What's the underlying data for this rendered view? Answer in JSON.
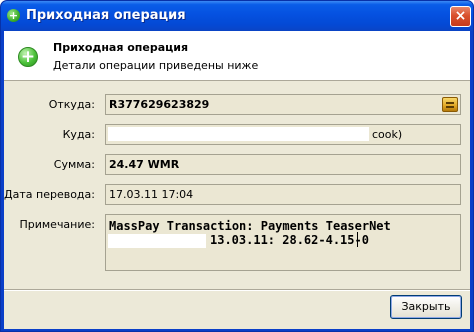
{
  "window": {
    "title": "Приходная операция",
    "close_glyph": "×"
  },
  "header": {
    "icon": "plus-circle-icon",
    "title": "Приходная операция",
    "subtitle": "Детали операции приведены ниже"
  },
  "form": {
    "from_label": "Откуда:",
    "from_value": "R377629623829",
    "to_label": "Куда:",
    "to_value": "cook)",
    "amount_label": "Сумма:",
    "amount_value": "24.47 WMR",
    "date_label": "Дата перевода:",
    "date_value": "17.03.11 17:04",
    "note_label": "Примечание:",
    "note_line1": "MassPay Transaction: Payments TeaserNet",
    "note_line2": "13.03.11: 28.62-4.15-0"
  },
  "footer": {
    "close_label": "Закрыть"
  },
  "colors": {
    "titlebar": "#0551e0",
    "client_bg": "#ece9d8",
    "field_bg": "#ebe7d3",
    "accent_green": "#3cae2b"
  }
}
